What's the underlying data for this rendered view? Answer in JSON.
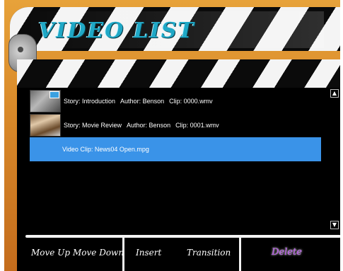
{
  "header": {
    "title": "VIDEO LIST"
  },
  "list": {
    "items": [
      {
        "story": "Story: Introduction",
        "author": "Author: Benson",
        "clip": "Clip: 0000.wmv",
        "selected": false
      },
      {
        "story": "Story: Movie Review",
        "author": "Author: Benson",
        "clip": "Clip: 0001.wmv",
        "selected": false
      },
      {
        "label": "Video Clip: News04 Open.mpg",
        "selected": true
      }
    ]
  },
  "scrollbar": {
    "up_icon": "▲",
    "down_icon": "▼"
  },
  "toolbar": {
    "move_up": "Move Up",
    "move_down": "Move Down",
    "insert": "Insert",
    "transition": "Transition",
    "delete": "Delete"
  },
  "colors": {
    "accent_title": "#1fa8c6",
    "selection": "#3a93e8",
    "delete": "#b34fe8"
  }
}
